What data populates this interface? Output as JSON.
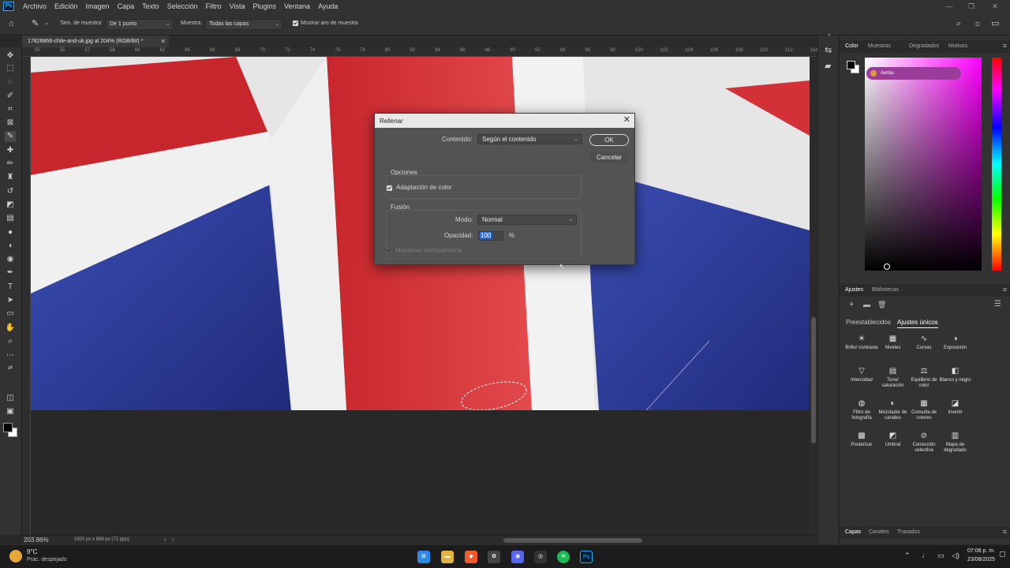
{
  "menubar": {
    "logo": "Ps",
    "items": [
      "Archivo",
      "Edición",
      "Imagen",
      "Capa",
      "Texto",
      "Selección",
      "Filtro",
      "Vista",
      "Plugins",
      "Ventana",
      "Ayuda"
    ]
  },
  "options": {
    "sample_size_label": "Tam. de muestra:",
    "sample_size_value": "De 1 punto",
    "sample_label": "Muestra:",
    "sample_value": "Todas las capas",
    "show_ring_label": "Mostrar aro de muestra",
    "show_ring_checked": true
  },
  "document": {
    "tab_title": "17828866-chile-and-uk.jpg al 204% (RGB/8#) *",
    "zoom": "203.86%",
    "doc_info": "1920 px x 868 px (72 ppp)"
  },
  "ruler": {
    "labels": [
      "50",
      "55",
      "57",
      "58",
      "60",
      "62",
      "64",
      "66",
      "68",
      "70",
      "72",
      "74",
      "76",
      "78",
      "80",
      "82",
      "84",
      "86",
      "88",
      "90",
      "92",
      "94",
      "96",
      "98",
      "100",
      "102",
      "104",
      "106",
      "108",
      "110",
      "112",
      "114"
    ]
  },
  "dialog": {
    "title": "Rellenar",
    "content_label": "Contenido:",
    "content_value": "Según el contenido",
    "ok": "OK",
    "cancel": "Cancelar",
    "options_title": "Opciones",
    "color_adapt_label": "Adaptación de color",
    "color_adapt_checked": true,
    "blend_title": "Fusión",
    "mode_label": "Modo:",
    "mode_value": "Normal",
    "opacity_label": "Opacidad:",
    "opacity_value": "100",
    "opacity_unit": "%",
    "preserve_label": "Mantener transparencia",
    "preserve_enabled": false
  },
  "panels": {
    "color_tabs": [
      "Color",
      "Muestras",
      "Degradados",
      "Motivos"
    ],
    "tooltip": "Aerlas",
    "adjust_tabs": [
      "Ajustes",
      "Bibliotecas"
    ],
    "adjust_subtabs": [
      "Preestablecidos",
      "Ajustes únicos"
    ],
    "adjustments": [
      {
        "label": "Brillo/ contraste",
        "icon": "brightness-icon"
      },
      {
        "label": "Niveles",
        "icon": "levels-icon"
      },
      {
        "label": "Curvas",
        "icon": "curves-icon"
      },
      {
        "label": "Exposición",
        "icon": "exposure-icon"
      },
      {
        "label": "Intensidad",
        "icon": "vibrance-icon"
      },
      {
        "label": "Tono/ saturación",
        "icon": "hue-saturation-icon"
      },
      {
        "label": "Equilibrio de color",
        "icon": "color-balance-icon"
      },
      {
        "label": "Blanco y negro",
        "icon": "black-white-icon"
      },
      {
        "label": "Filtro de fotografía",
        "icon": "photo-filter-icon"
      },
      {
        "label": "Mezclador de canales",
        "icon": "channel-mixer-icon"
      },
      {
        "label": "Consulta de colores",
        "icon": "color-lookup-icon"
      },
      {
        "label": "Invertir",
        "icon": "invert-icon"
      },
      {
        "label": "Posterizar",
        "icon": "posterize-icon"
      },
      {
        "label": "Umbral",
        "icon": "threshold-icon"
      },
      {
        "label": "Corrección selectiva",
        "icon": "selective-color-icon"
      },
      {
        "label": "Mapa de degradado",
        "icon": "gradient-map-icon"
      }
    ],
    "layer_tabs": [
      "Capas",
      "Canales",
      "Trazados"
    ]
  },
  "taskbar": {
    "temperature": "9°C",
    "weather": "Prac. despejado",
    "time": "07:08 p. m.",
    "date": "23/08/2025",
    "apps": [
      "windows-start-icon",
      "file-explorer-icon",
      "brave-icon",
      "app-icon",
      "discord-icon",
      "app-icon",
      "spotify-icon",
      "photoshop-icon"
    ]
  },
  "colors": {
    "flag_red": "#d8393c",
    "flag_blue": "#2d3f9e",
    "flag_white": "#ececec",
    "accent": "#31a8ff"
  }
}
